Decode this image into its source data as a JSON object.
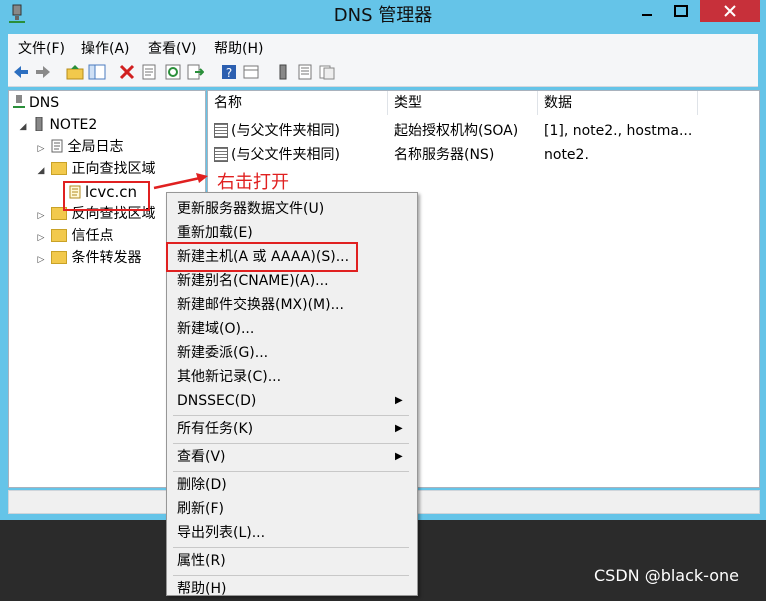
{
  "window": {
    "title": "DNS 管理器"
  },
  "menubar": [
    "文件(F)",
    "操作(A)",
    "查看(V)",
    "帮助(H)"
  ],
  "toolbar": [
    "back-icon",
    "forward-icon",
    "up-folder-icon",
    "show-tree-icon",
    "delete-icon",
    "properties-icon",
    "refresh-icon",
    "export-icon",
    "help-icon",
    "view-icon",
    "server-icon",
    "list-icon",
    "record-icon"
  ],
  "tree": {
    "root": "DNS",
    "server": "NOTE2",
    "items": [
      "全局日志",
      "正向查找区域",
      "lcvc.cn",
      "反向查找区域",
      "信任点",
      "条件转发器"
    ]
  },
  "list": {
    "columns": [
      "名称",
      "类型",
      "数据"
    ],
    "rows": [
      {
        "name": "(与父文件夹相同)",
        "type": "起始授权机构(SOA)",
        "data": "[1], note2., hostma..."
      },
      {
        "name": "(与父文件夹相同)",
        "type": "名称服务器(NS)",
        "data": "note2."
      }
    ]
  },
  "annotation": {
    "text": "右击打开",
    "color": "#e02020"
  },
  "context_menu": {
    "items": [
      "更新服务器数据文件(U)",
      "重新加载(E)",
      "新建主机(A 或 AAAA)(S)...",
      "新建别名(CNAME)(A)...",
      "新建邮件交换器(MX)(M)...",
      "新建域(O)...",
      "新建委派(G)...",
      "其他新记录(C)...",
      "DNSSEC(D)",
      "所有任务(K)",
      "查看(V)",
      "删除(D)",
      "刷新(F)",
      "导出列表(L)...",
      "属性(R)",
      "帮助(H)"
    ]
  },
  "watermark": "CSDN @black-one",
  "colors": {
    "titlebar": "#65c4e8",
    "close": "#c7303a",
    "highlight_box": "#e02020"
  }
}
